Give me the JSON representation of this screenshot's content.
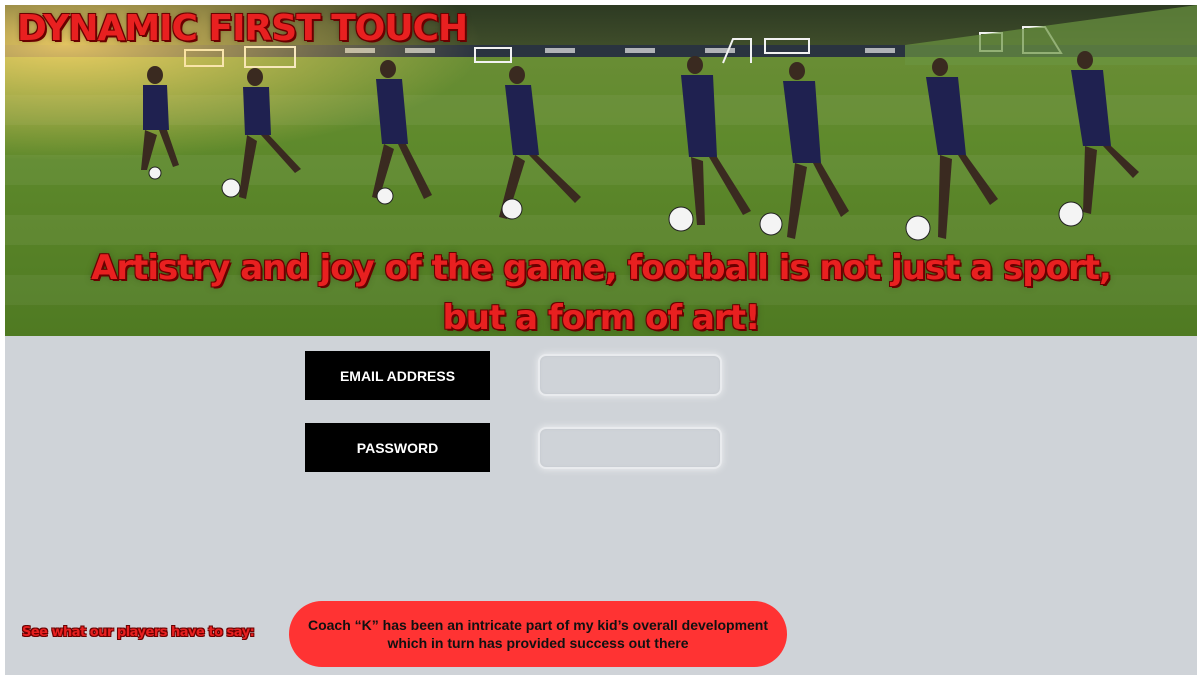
{
  "hero": {
    "brand_title": "DYNAMIC FIRST TOUCH",
    "tagline_line1": "Artistry and joy of the game, football is not just a sport,",
    "tagline_line2": "but a form of art!",
    "image_description": "soccer-players-dribbling-photo"
  },
  "login": {
    "email_label": "EMAIL ADDRESS",
    "email_value": "",
    "password_label": "PASSWORD",
    "password_value": ""
  },
  "testimonials": {
    "prompt": "See what our players have to say:",
    "quote_line1": "Coach “K” has been an intricate part of my kid’s overall development",
    "quote_line2": "which in turn has provided success out there"
  },
  "colors": {
    "accent_red": "#e82020",
    "testimonial_bg": "#ff3333",
    "page_bg": "#cfd3d8",
    "label_bg": "#000000"
  }
}
